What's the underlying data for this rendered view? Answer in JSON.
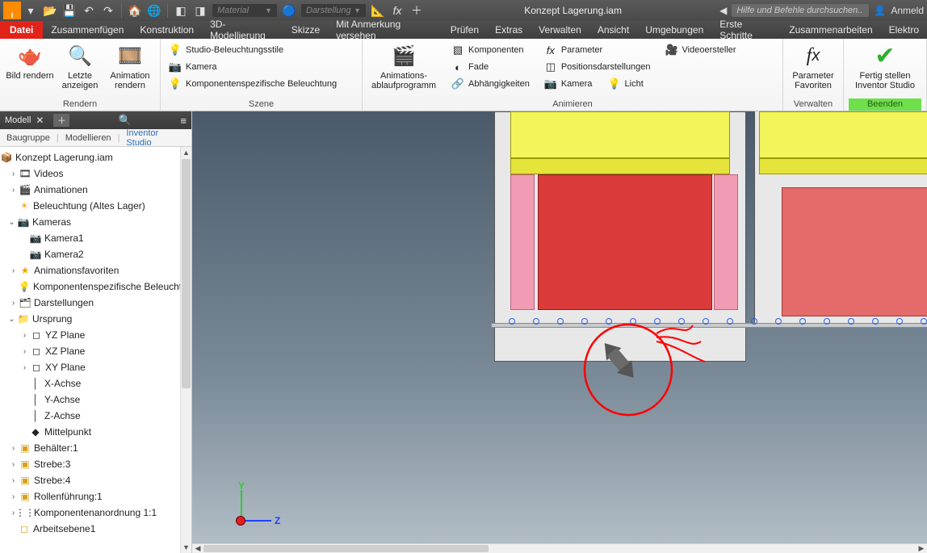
{
  "app": {
    "doc_title": "Konzept Lagerung.iam"
  },
  "qat": {
    "material_placeholder": "Material",
    "appearance_placeholder": "Darstellung",
    "search_placeholder": "Hilfe und Befehle durchsuchen..",
    "signin": "Anmeld"
  },
  "menu": {
    "file": "Datei",
    "items": [
      "Zusammenfügen",
      "Konstruktion",
      "3D-Modellierung",
      "Skizze",
      "Mit Anmerkung versehen",
      "Prüfen",
      "Extras",
      "Verwalten",
      "Ansicht",
      "Umgebungen",
      "Erste Schritte",
      "Zusammenarbeiten",
      "Elektro"
    ]
  },
  "ribbon": {
    "render": {
      "title": "Rendern",
      "bild": "Bild\nrendern",
      "letzte": "Letzte\nanzeigen",
      "anim": "Animation\nrendern"
    },
    "szene": {
      "title": "Szene",
      "studio": "Studio-Beleuchtungsstile",
      "kamera": "Kamera",
      "kompbel": "Komponentenspezifische Beleuchtung"
    },
    "animieren": {
      "title": "Animieren",
      "program": "Animations-\nablaufprogramm",
      "komponenten": "Komponenten",
      "fade": "Fade",
      "abh": "Abhängigkeiten",
      "parameter": "Parameter",
      "positions": "Positionsdarstellungen",
      "kamera": "Kamera",
      "licht": "Licht",
      "video": "Videoersteller"
    },
    "verwalten": {
      "title": "Verwalten",
      "paramfav": "Parameter\nFavoriten"
    },
    "beenden": {
      "title": "Beenden",
      "fertig": "Fertig stellen\nInventor Studio"
    }
  },
  "side": {
    "header": "Modell",
    "tabs": {
      "baugruppe": "Baugruppe",
      "modellieren": "Modellieren",
      "studio": "Inventor Studio"
    }
  },
  "tree": {
    "root": "Konzept Lagerung.iam",
    "videos": "Videos",
    "animationen": "Animationen",
    "beleuchtung": "Beleuchtung (Altes Lager)",
    "kameras": "Kameras",
    "kamera1": "Kamera1",
    "kamera2": "Kamera2",
    "animfav": "Animationsfavoriten",
    "kompbel": "Komponentenspezifische Beleuchtung",
    "darst": "Darstellungen",
    "ursprung": "Ursprung",
    "yz": "YZ Plane",
    "xz": "XZ Plane",
    "xy": "XY Plane",
    "xa": "X-Achse",
    "ya": "Y-Achse",
    "za": "Z-Achse",
    "mittel": "Mittelpunkt",
    "beh": "Behälter:1",
    "str3": "Strebe:3",
    "str4": "Strebe:4",
    "roll": "Rollenführung:1",
    "kompanord": "Komponentenanordnung 1:1",
    "arbeit": "Arbeitsebene1"
  },
  "axes": {
    "y": "Y",
    "z": "Z"
  }
}
